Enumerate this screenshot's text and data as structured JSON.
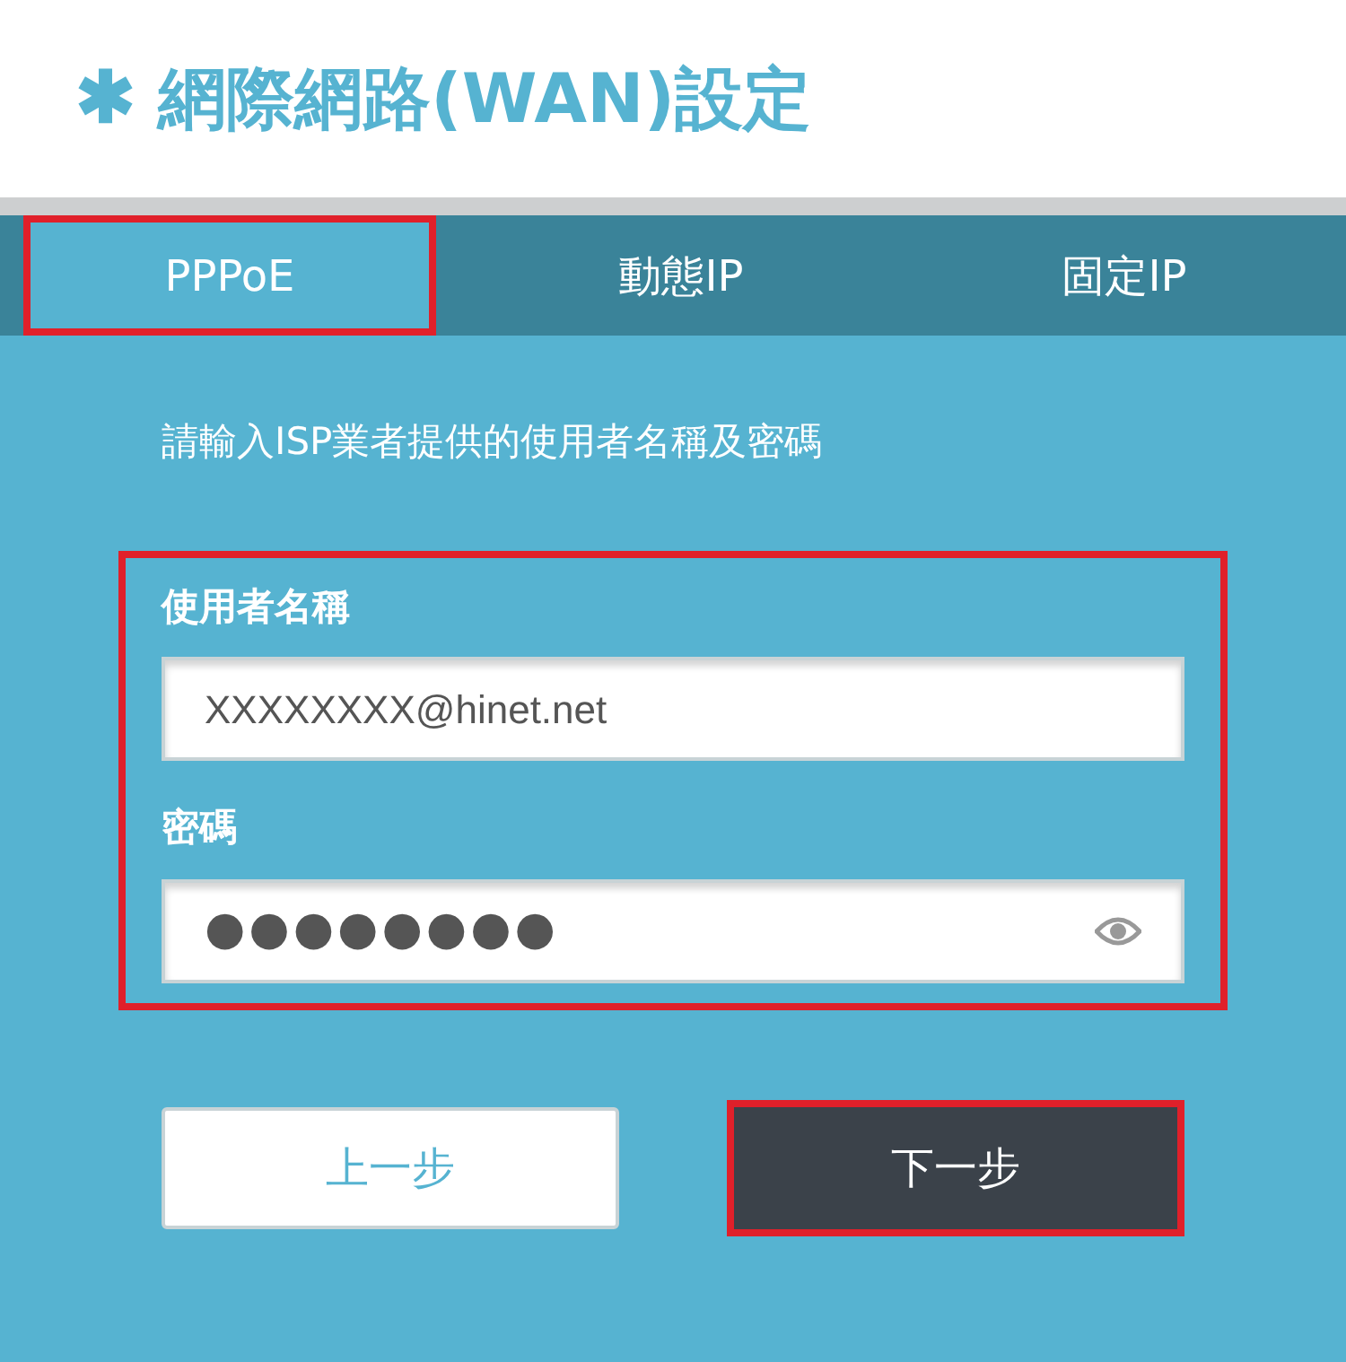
{
  "header": {
    "icon": "✱",
    "title": "網際網路(WAN)設定"
  },
  "tabs": [
    {
      "label": "PPPoE",
      "selected": true,
      "highlighted": true
    },
    {
      "label": "動態IP",
      "selected": false,
      "highlighted": false
    },
    {
      "label": "固定IP",
      "selected": false,
      "highlighted": false
    }
  ],
  "instruction": "請輸入ISP業者提供的使用者名稱及密碼",
  "form": {
    "highlighted": true,
    "fields": [
      {
        "kind": "text",
        "label": "使用者名稱",
        "value": "XXXXXXXX@hinet.net"
      },
      {
        "kind": "password",
        "label": "密碼",
        "value": "●●●●●●●●"
      }
    ]
  },
  "buttons": [
    {
      "label": "上一步",
      "kind": "secondary",
      "highlighted": false
    },
    {
      "label": "下一步",
      "kind": "primary",
      "highlighted": true
    }
  ]
}
